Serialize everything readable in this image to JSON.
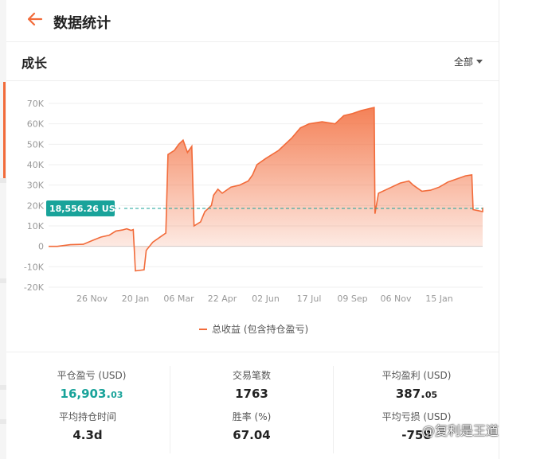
{
  "header": {
    "title": "数据统计"
  },
  "section": {
    "title": "成长",
    "filter_label": "全部"
  },
  "chart_data": {
    "type": "line",
    "y_ticks": [
      "70K",
      "60K",
      "50K",
      "40K",
      "30K",
      "20K",
      "10K",
      "0",
      "-10K",
      "-20K"
    ],
    "x_ticks": [
      "26 Nov",
      "20 Jan",
      "06 Mar",
      "22 Apr",
      "02 Jun",
      "17 Jul",
      "09 Sep",
      "06 Nov",
      "15 Jan"
    ],
    "ylim": [
      -20000,
      70000
    ],
    "current_value_label": "18,556.26 USD",
    "current_value": 18556.26,
    "series": [
      {
        "name": "总收益 (包含持仓盈亏)",
        "color": "#f26b3a",
        "values": [
          [
            0,
            0
          ],
          [
            0.02,
            0
          ],
          [
            0.05,
            800
          ],
          [
            0.08,
            1000
          ],
          [
            0.1,
            2800
          ],
          [
            0.12,
            4500
          ],
          [
            0.14,
            5500
          ],
          [
            0.155,
            7500
          ],
          [
            0.17,
            8000
          ],
          [
            0.18,
            8600
          ],
          [
            0.19,
            7800
          ],
          [
            0.195,
            8200
          ],
          [
            0.2,
            -12000
          ],
          [
            0.22,
            -11500
          ],
          [
            0.225,
            -2000
          ],
          [
            0.24,
            2000
          ],
          [
            0.26,
            5000
          ],
          [
            0.27,
            6500
          ],
          [
            0.275,
            45000
          ],
          [
            0.29,
            47000
          ],
          [
            0.3,
            50000
          ],
          [
            0.31,
            52000
          ],
          [
            0.32,
            46000
          ],
          [
            0.33,
            49000
          ],
          [
            0.335,
            10000
          ],
          [
            0.35,
            12000
          ],
          [
            0.36,
            17000
          ],
          [
            0.375,
            20000
          ],
          [
            0.38,
            25000
          ],
          [
            0.39,
            28000
          ],
          [
            0.4,
            26000
          ],
          [
            0.42,
            29000
          ],
          [
            0.44,
            30000
          ],
          [
            0.46,
            32000
          ],
          [
            0.47,
            35000
          ],
          [
            0.48,
            40000
          ],
          [
            0.5,
            43000
          ],
          [
            0.53,
            47000
          ],
          [
            0.56,
            53000
          ],
          [
            0.58,
            58000
          ],
          [
            0.6,
            60000
          ],
          [
            0.63,
            61000
          ],
          [
            0.66,
            60000
          ],
          [
            0.68,
            64000
          ],
          [
            0.7,
            65000
          ],
          [
            0.72,
            66500
          ],
          [
            0.74,
            67500
          ],
          [
            0.75,
            68000
          ],
          [
            0.752,
            16000
          ],
          [
            0.76,
            26000
          ],
          [
            0.78,
            28000
          ],
          [
            0.81,
            31000
          ],
          [
            0.83,
            32000
          ],
          [
            0.84,
            30000
          ],
          [
            0.86,
            27000
          ],
          [
            0.88,
            27500
          ],
          [
            0.9,
            29000
          ],
          [
            0.92,
            31500
          ],
          [
            0.94,
            33000
          ],
          [
            0.96,
            34500
          ],
          [
            0.975,
            35000
          ],
          [
            0.978,
            18000
          ],
          [
            0.99,
            17500
          ],
          [
            1.0,
            17000
          ],
          [
            1.005,
            19000
          ]
        ]
      }
    ]
  },
  "stats": [
    {
      "label": "平仓盈亏 (USD)",
      "value_main": "16,903.",
      "value_dec": "03",
      "highlight": true
    },
    {
      "label": "交易笔数",
      "value_main": "1763",
      "value_dec": "",
      "highlight": false
    },
    {
      "label": "平均盈利 (USD)",
      "value_main": "387.",
      "value_dec": "05",
      "highlight": false
    },
    {
      "label": "平均持仓时间",
      "value_main": "4.3d",
      "value_dec": "",
      "highlight": false
    },
    {
      "label": "胜率 (%)",
      "value_main": "67.04",
      "value_dec": "",
      "highlight": false
    },
    {
      "label": "平均亏损 (USD)",
      "value_main": "-758",
      "value_dec": "",
      "highlight": false
    }
  ],
  "watermark": {
    "text": "@复利是王道"
  }
}
